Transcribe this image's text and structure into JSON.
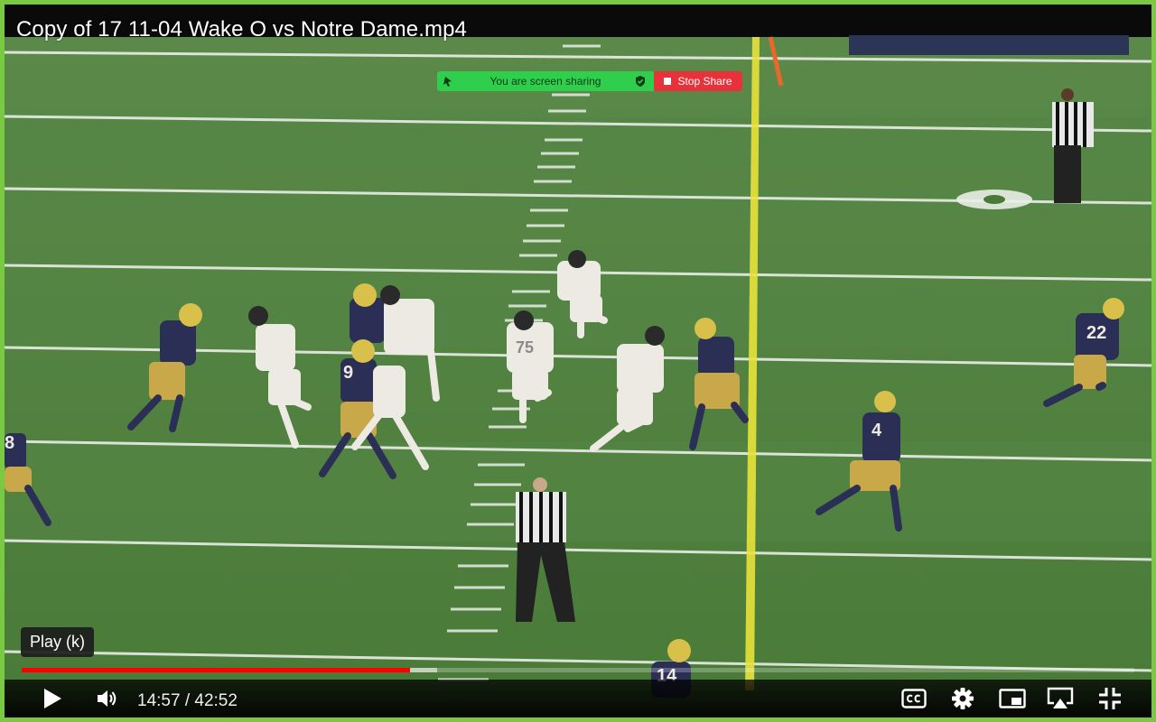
{
  "player": {
    "title": "Copy of 17 11-04 Wake O vs Notre Dame.mp4",
    "tooltip": "Play (k)",
    "current_time": "14:57",
    "time_separator": " / ",
    "duration": "42:52",
    "progress_fraction": 0.349,
    "buffered_fraction": 0.373
  },
  "screen_share": {
    "status_text": "You are screen sharing",
    "stop_label": "Stop Share"
  },
  "field": {
    "jersey_numbers": [
      "22",
      "4",
      "9",
      "75",
      "14",
      "8"
    ]
  },
  "controls": {
    "icons": [
      "play-icon",
      "volume-icon",
      "captions-icon",
      "settings-icon",
      "miniplayer-icon",
      "airplay-icon",
      "exit-fullscreen-icon"
    ]
  },
  "colors": {
    "frame_border": "#7ac943",
    "progress_played": "#ff0000",
    "share_green": "#2fcf4d",
    "stop_red": "#e8323b",
    "field_green": "#4f7d3e"
  }
}
